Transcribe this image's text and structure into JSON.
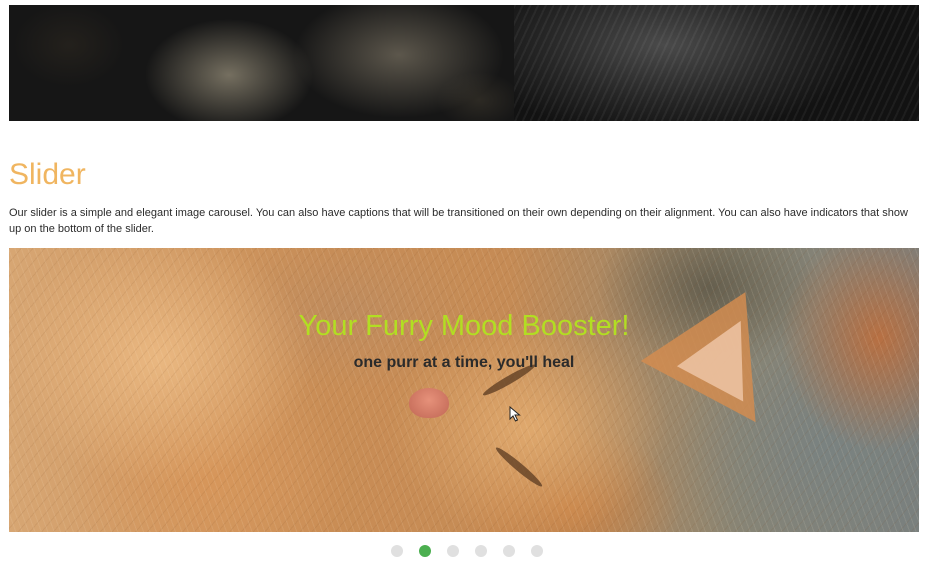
{
  "section": {
    "title": "Slider",
    "description": "Our slider is a simple and elegant image carousel. You can also have captions that will be transitioned on their own depending on their alignment. You can also have indicators that show up on the bottom of the slider."
  },
  "slider": {
    "active_index": 1,
    "caption": {
      "title": "Your Furry Mood Booster!",
      "subtitle": "one purr at a time, you'll heal",
      "title_color": "#b2de22"
    },
    "indicators": [
      {
        "active": false
      },
      {
        "active": true
      },
      {
        "active": false
      },
      {
        "active": false
      },
      {
        "active": false
      },
      {
        "active": false
      }
    ]
  },
  "colors": {
    "title_accent": "#f0b560",
    "indicator_active": "#4caf50",
    "indicator_inactive": "#e0e0e0"
  }
}
